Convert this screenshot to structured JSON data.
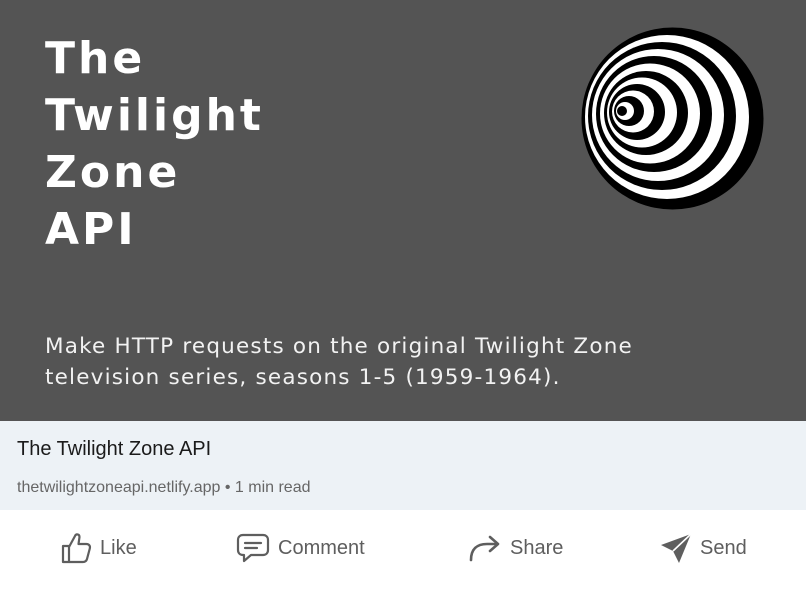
{
  "hero": {
    "title_lines": [
      "The",
      "Twilight",
      "Zone",
      "API"
    ],
    "description_lines": [
      "Make HTTP requests on the original Twilight Zone",
      "television series, seasons 1-5 (1959-1964)."
    ],
    "logo_icon": "spiral-target-icon",
    "background": "#545454"
  },
  "link": {
    "title": "The Twilight Zone API",
    "source": "thetwilightzoneapi.netlify.app",
    "separator": "•",
    "read_time": "1 min read"
  },
  "actions": [
    {
      "label": "Like",
      "icon": "thumbs-up-icon"
    },
    {
      "label": "Comment",
      "icon": "comment-icon"
    },
    {
      "label": "Share",
      "icon": "share-arrow-icon"
    },
    {
      "label": "Send",
      "icon": "send-paper-plane-icon"
    }
  ]
}
